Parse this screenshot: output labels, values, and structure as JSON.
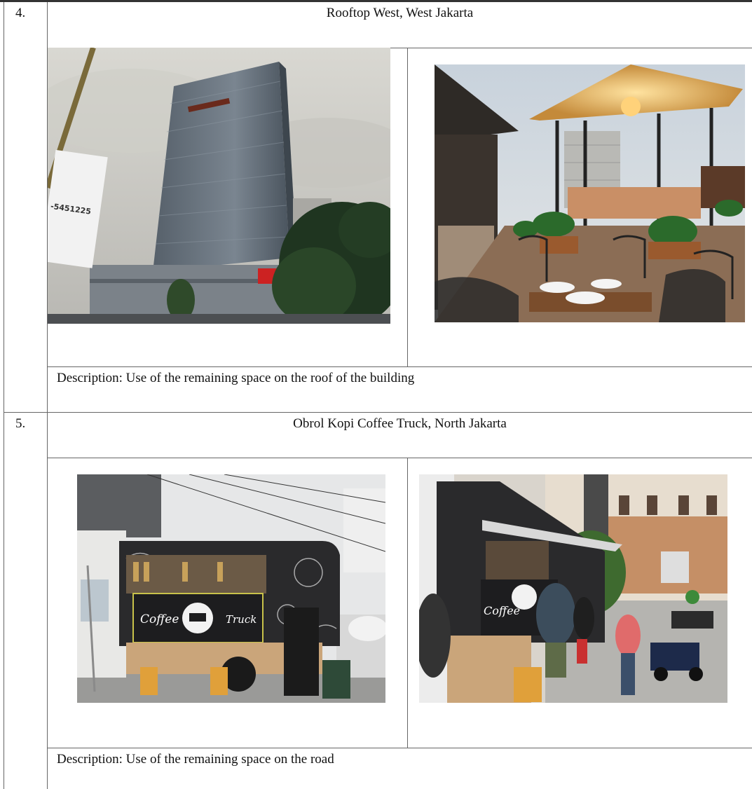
{
  "entries": [
    {
      "number": "4.",
      "title": "Rooftop West, West Jakarta",
      "description": "Description: Use of the remaining space on the roof of the building",
      "photos": [
        {
          "subject": "glass office tower with sign \"-5451225\"",
          "sign_text": "-5451225"
        },
        {
          "subject": "rooftop terrace with gazebo, dining tables and plants"
        }
      ]
    },
    {
      "number": "5.",
      "title": "Obrol Kopi Coffee Truck, North Jakarta",
      "description": "Description: Use of the remaining space on the road",
      "photos": [
        {
          "subject": "black coffee truck parked on street",
          "banner_left": "Coffee",
          "banner_right": "Truck"
        },
        {
          "subject": "customers queuing at coffee truck",
          "banner_left": "Coffee"
        }
      ]
    }
  ]
}
